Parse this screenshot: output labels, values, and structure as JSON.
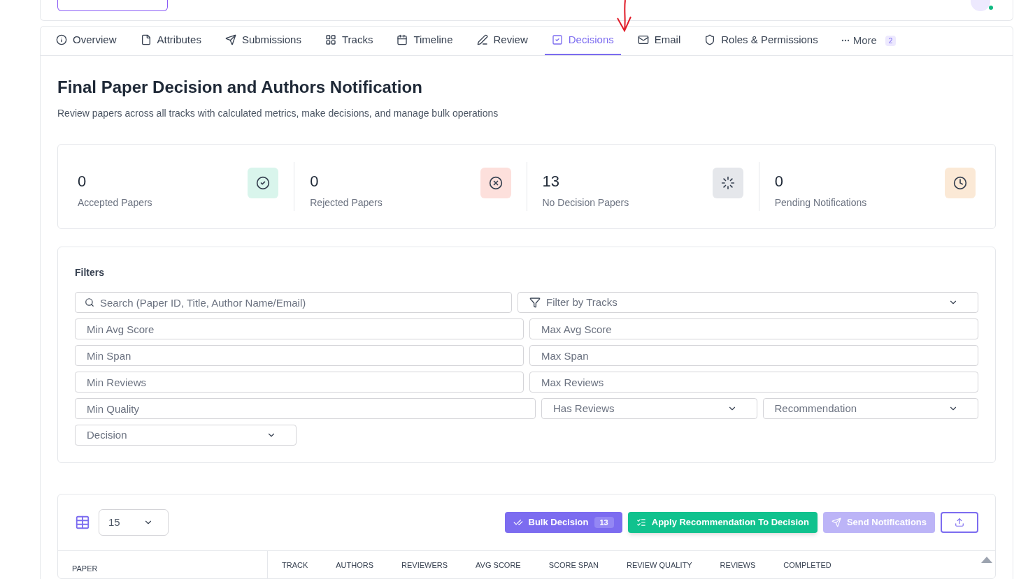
{
  "tabs": [
    {
      "label": "Overview",
      "selected": false
    },
    {
      "label": "Attributes",
      "selected": false
    },
    {
      "label": "Submissions",
      "selected": false
    },
    {
      "label": "Tracks",
      "selected": false
    },
    {
      "label": "Timeline",
      "selected": false
    },
    {
      "label": "Review",
      "selected": false
    },
    {
      "label": "Decisions",
      "selected": true
    },
    {
      "label": "Email",
      "selected": false
    },
    {
      "label": "Roles & Permissions",
      "selected": false
    }
  ],
  "more": {
    "label": "More",
    "count": "2"
  },
  "title": "Final Paper Decision and Authors Notification",
  "subtitle": "Review papers across all tracks with calculated metrics, make decisions, and manage bulk operations",
  "stats": [
    {
      "value": "0",
      "label": "Accepted Papers",
      "color": "#d9f5ec"
    },
    {
      "value": "0",
      "label": "Rejected Papers",
      "color": "#fde0dc"
    },
    {
      "value": "13",
      "label": "No Decision Papers",
      "color": "#e5e7eb"
    },
    {
      "value": "0",
      "label": "Pending Notifications",
      "color": "#fbe9d6"
    }
  ],
  "filters": {
    "title": "Filters",
    "rows": [
      [
        {
          "kind": "search",
          "placeholder": "Search (Paper ID, Title, Author Name/Email)"
        },
        {
          "kind": "filter",
          "placeholder": "Filter by Tracks"
        }
      ],
      [
        {
          "kind": "input",
          "placeholder": "Min Avg Score"
        },
        {
          "kind": "input",
          "placeholder": "Max Avg Score"
        }
      ],
      [
        {
          "kind": "input",
          "placeholder": "Min Span"
        },
        {
          "kind": "input",
          "placeholder": "Max Span"
        }
      ],
      [
        {
          "kind": "input",
          "placeholder": "Min Reviews"
        },
        {
          "kind": "input",
          "placeholder": "Max Reviews"
        }
      ],
      [
        {
          "kind": "input",
          "placeholder": "Min Quality"
        },
        {
          "kind": "select",
          "placeholder": "Has Reviews"
        },
        {
          "kind": "select",
          "placeholder": "Recommendation"
        }
      ],
      [
        {
          "kind": "select",
          "placeholder": "Decision"
        }
      ]
    ]
  },
  "table": {
    "page_size": "15",
    "buttons": [
      {
        "kind": "bulk",
        "label": "Bulk Decision",
        "count": "13",
        "disabled": false
      },
      {
        "kind": "apply",
        "label": "Apply Recommendation To Decision",
        "disabled": false
      },
      {
        "kind": "send",
        "label": "Send Notifications",
        "disabled": true
      },
      {
        "kind": "export",
        "disabled": false
      }
    ],
    "columns": [
      "PAPER",
      "TRACK",
      "AUTHORS",
      "REVIEWERS",
      "AVG SCORE",
      "SCORE SPAN",
      "REVIEW QUALITY",
      "REVIEWS",
      "COMPLETED"
    ]
  }
}
